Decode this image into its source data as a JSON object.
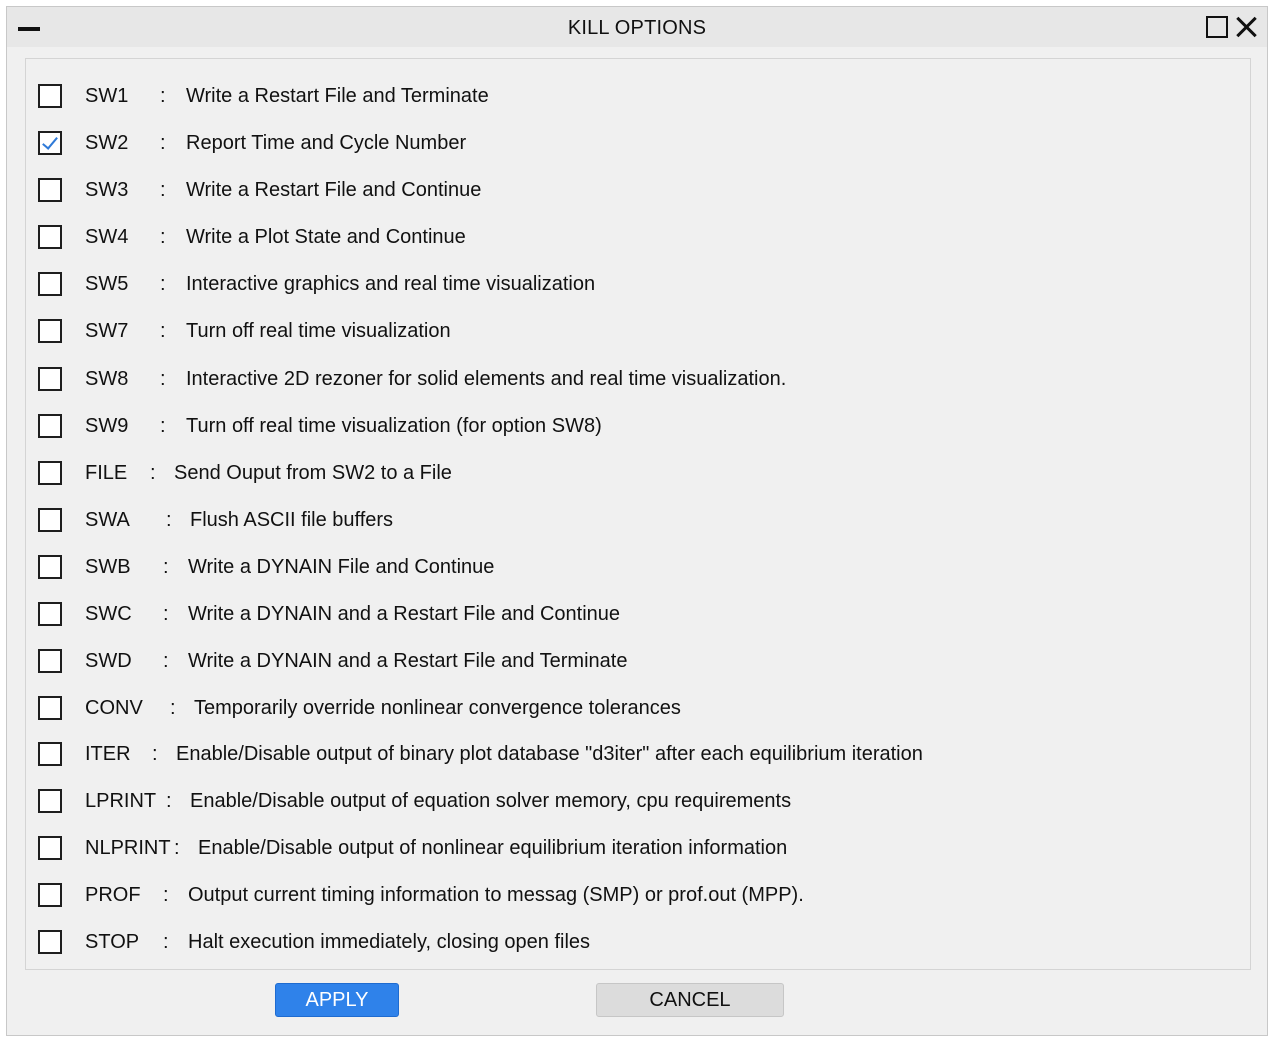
{
  "window": {
    "title": "KILL OPTIONS"
  },
  "options": [
    {
      "code": "SW1",
      "separator": ":",
      "description": "Write a Restart File and Terminate",
      "checked": false
    },
    {
      "code": "SW2",
      "separator": ":",
      "description": "Report Time and Cycle Number",
      "checked": true
    },
    {
      "code": "SW3",
      "separator": ":",
      "description": "Write a Restart File and Continue",
      "checked": false
    },
    {
      "code": "SW4",
      "separator": ":",
      "description": "Write a Plot State and Continue",
      "checked": false
    },
    {
      "code": "SW5",
      "separator": ":",
      "description": "Interactive graphics and real time visualization",
      "checked": false
    },
    {
      "code": "SW7",
      "separator": ":",
      "description": "Turn off real time visualization",
      "checked": false
    },
    {
      "code": "SW8",
      "separator": ":",
      "description": "Interactive 2D rezoner for solid elements and real time visualization.",
      "checked": false
    },
    {
      "code": "SW9",
      "separator": ":",
      "description": "Turn off real time visualization (for option SW8)",
      "checked": false
    },
    {
      "code": "FILE",
      "separator": ":",
      "description": "Send Ouput from SW2 to a File",
      "checked": false
    },
    {
      "code": "SWA",
      "separator": ":",
      "description": "Flush ASCII file buffers",
      "checked": false
    },
    {
      "code": "SWB",
      "separator": ":",
      "description": "Write a DYNAIN File and Continue",
      "checked": false
    },
    {
      "code": "SWC",
      "separator": ":",
      "description": "Write a DYNAIN and a Restart File and Continue",
      "checked": false
    },
    {
      "code": "SWD",
      "separator": ":",
      "description": "Write a DYNAIN and a Restart File and Terminate",
      "checked": false
    },
    {
      "code": "CONV",
      "separator": ":",
      "description": "Temporarily override nonlinear convergence tolerances",
      "checked": false
    },
    {
      "code": "ITER",
      "separator": ":",
      "description": "Enable/Disable output of binary plot database \"d3iter\" after each equilibrium iteration",
      "checked": false
    },
    {
      "code": "LPRINT",
      "separator": ":",
      "description": "Enable/Disable output of equation solver memory, cpu requirements",
      "checked": false
    },
    {
      "code": "NLPRINT",
      "separator": ":",
      "description": "Enable/Disable output of nonlinear equilibrium iteration information",
      "checked": false
    },
    {
      "code": "PROF",
      "separator": ":",
      "description": "Output current timing information to messag (SMP) or prof.out (MPP).",
      "checked": false
    },
    {
      "code": "STOP",
      "separator": ":",
      "description": "Halt execution immediately, closing open files",
      "checked": false
    }
  ],
  "buttons": {
    "apply_label": "APPLY",
    "cancel_label": "CANCEL"
  },
  "colors": {
    "accent": "#2f82ea",
    "check_mark": "#2f7ad8",
    "window_bg": "#f0f0f0",
    "titlebar_bg": "#e7e7e7"
  },
  "icons": {
    "minimize": "minimize-icon",
    "maximize": "maximize-icon",
    "close": "close-icon",
    "check": "check-icon"
  }
}
